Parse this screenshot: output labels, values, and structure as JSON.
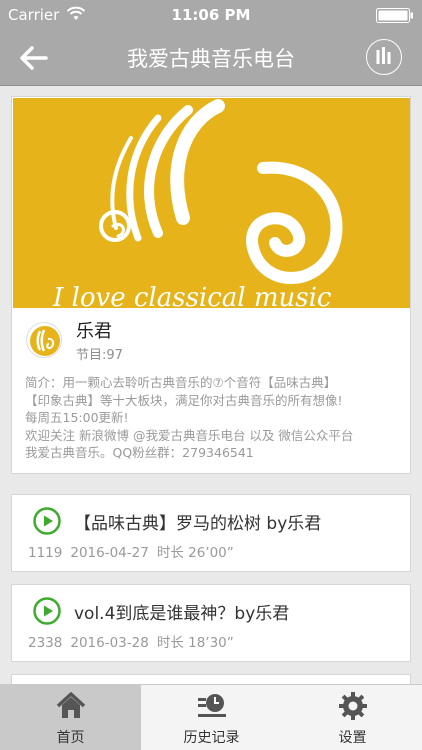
{
  "status_bar": {
    "carrier": "Carrier",
    "time": "11:06 PM",
    "wifi_icon": "wifi-icon",
    "battery_icon": "battery-icon"
  },
  "nav": {
    "title": "我爱古典音乐电台",
    "back_icon": "back-arrow-icon",
    "menu_icon": "equalizer-icon"
  },
  "banner": {
    "text": "I love classical music"
  },
  "profile": {
    "name": "乐君",
    "episodes_label": "节目:",
    "episodes_count": "97",
    "intro_lines": [
      "简介：用一颗心去聆听古典音乐的⑦个音符【品味古典】",
      "【印象古典】等十大板块，满足你对古典音乐的所有想像!",
      "每周五15:00更新!",
      "欢迎关注 新浪微博 @我爱古典音乐电台 以及 微信公众平台",
      "我爱古典音乐。QQ粉丝群：279346541"
    ]
  },
  "tracks": [
    {
      "title": "【品味古典】罗马的松树 by乐君",
      "plays": "1119",
      "date": "2016-04-27",
      "duration": "时长 26’00”"
    },
    {
      "title": "vol.4到底是谁最神？by乐君",
      "plays": "2338",
      "date": "2016-03-28",
      "duration": "时长 18’30”"
    }
  ],
  "tabs": [
    {
      "label": "首页",
      "icon": "home-icon",
      "active": true
    },
    {
      "label": "历史记录",
      "icon": "history-icon",
      "active": false
    },
    {
      "label": "设置",
      "icon": "gear-icon",
      "active": false
    }
  ],
  "colors": {
    "nav_bg": "#a9a9a9",
    "banner_bg": "#e6b41a",
    "play_green": "#3dab2c",
    "active_tab_bg": "#c9c9c9"
  }
}
